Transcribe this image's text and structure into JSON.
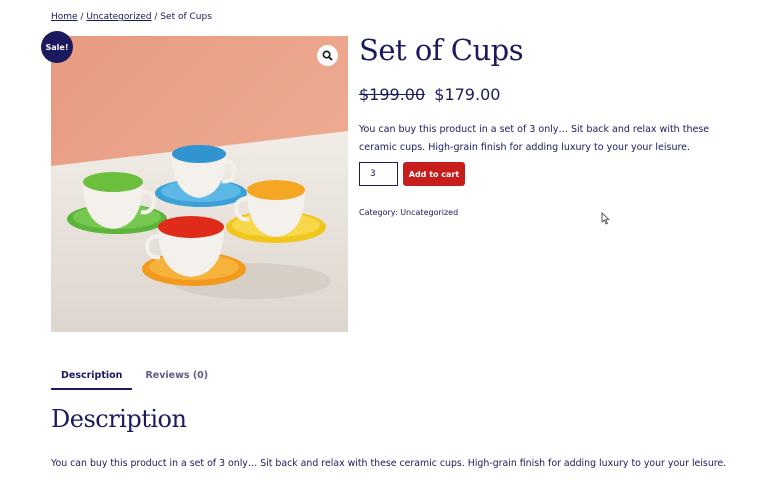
{
  "breadcrumb": {
    "home": "Home",
    "separator": " / ",
    "category": "Uncategorized",
    "current": "Set of Cups"
  },
  "product": {
    "badge": "Sale!",
    "title": "Set of Cups",
    "old_price": "$199.00",
    "price": "$179.00",
    "short_description": "You can buy this product in a set of 3 only… Sit back and relax with these ceramic cups. High-grain finish for adding luxury to your your leisure.",
    "quantity": "3",
    "add_to_cart_label": "Add to cart",
    "category_label": "Category:",
    "category_value": "Uncategorized",
    "image_icon": "zoom-icon"
  },
  "tabs": [
    {
      "label": "Description",
      "active": true
    },
    {
      "label": "Reviews (0)",
      "active": false
    }
  ],
  "description": {
    "heading": "Description",
    "body": "You can buy this product in a set of 3 only… Sit back and relax with these ceramic cups. High-grain finish for adding luxury to your your leisure."
  },
  "colors": {
    "primary": "#1b1a5e",
    "button": "#c81d1d",
    "image_wall": "#e89a7f",
    "image_table": "#ece7e1"
  }
}
